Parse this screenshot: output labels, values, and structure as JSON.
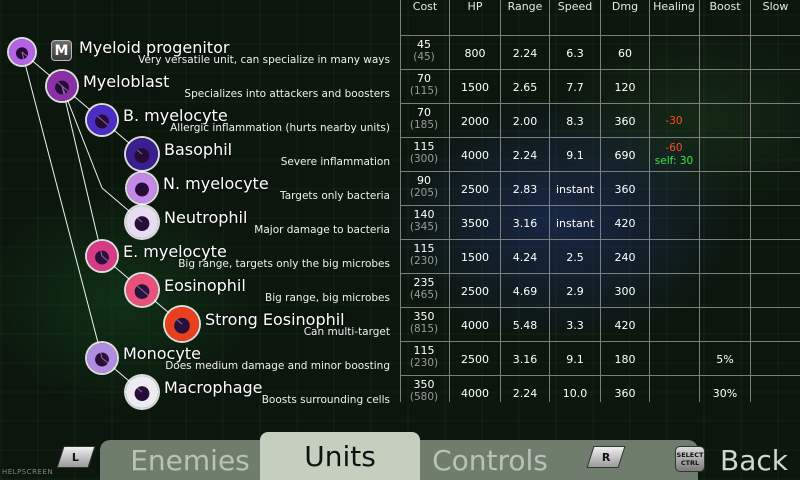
{
  "columns": {
    "cost": "Cost",
    "hp": "HP",
    "range": "Range",
    "speed": "Speed",
    "dmg": "Dmg",
    "healing": "Healing",
    "boost": "Boost",
    "slow": "Slow"
  },
  "badge": "M",
  "rows": [
    {
      "name": "Myeloid progenitor",
      "desc": "Very versatile unit, can specialize in many ways",
      "cost": "45",
      "cost_total": "(45)",
      "hp": "800",
      "range": "2.24",
      "speed": "6.3",
      "dmg": "60",
      "healing": "",
      "healing_self": "",
      "boost": "",
      "slow": "",
      "icon_color": "#b463e6"
    },
    {
      "name": "Myeloblast",
      "desc": "Specializes into attackers and boosters",
      "cost": "70",
      "cost_total": "(115)",
      "hp": "1500",
      "range": "2.65",
      "speed": "7.7",
      "dmg": "120",
      "healing": "",
      "healing_self": "",
      "boost": "",
      "slow": "",
      "icon_color": "#8a2fa5"
    },
    {
      "name": "B. myelocyte",
      "desc": "Allergic inflammation (hurts nearby units)",
      "cost": "70",
      "cost_total": "(185)",
      "hp": "2000",
      "range": "2.00",
      "speed": "8.3",
      "dmg": "360",
      "healing": "-30",
      "healing_self": "",
      "boost": "",
      "slow": "",
      "icon_color": "#4b2cc4"
    },
    {
      "name": "Basophil",
      "desc": "Severe inflammation",
      "cost": "115",
      "cost_total": "(300)",
      "hp": "4000",
      "range": "2.24",
      "speed": "9.1",
      "dmg": "690",
      "healing": "-60",
      "healing_self": "self: 30",
      "boost": "",
      "slow": "",
      "icon_color": "#3a1f8e"
    },
    {
      "name": "N. myelocyte",
      "desc": "Targets only bacteria",
      "cost": "90",
      "cost_total": "(205)",
      "hp": "2500",
      "range": "2.83",
      "speed": "instant",
      "dmg": "360",
      "healing": "",
      "healing_self": "",
      "boost": "",
      "slow": "",
      "icon_color": "#c48ae8"
    },
    {
      "name": "Neutrophil",
      "desc": "Major damage to bacteria",
      "cost": "140",
      "cost_total": "(345)",
      "hp": "3500",
      "range": "3.16",
      "speed": "instant",
      "dmg": "420",
      "healing": "",
      "healing_self": "",
      "boost": "",
      "slow": "",
      "icon_color": "#e9dcf2"
    },
    {
      "name": "E. myelocyte",
      "desc": "Big range, targets only the big microbes",
      "cost": "115",
      "cost_total": "(230)",
      "hp": "1500",
      "range": "4.24",
      "speed": "2.5",
      "dmg": "240",
      "healing": "",
      "healing_self": "",
      "boost": "",
      "slow": "",
      "icon_color": "#d83b85"
    },
    {
      "name": "Eosinophil",
      "desc": "Big range, big microbes",
      "cost": "235",
      "cost_total": "(465)",
      "hp": "2500",
      "range": "4.69",
      "speed": "2.9",
      "dmg": "300",
      "healing": "",
      "healing_self": "",
      "boost": "",
      "slow": "",
      "icon_color": "#e9507a"
    },
    {
      "name": "Strong Eosinophil",
      "desc": "Can multi-target",
      "cost": "350",
      "cost_total": "(815)",
      "hp": "4000",
      "range": "5.48",
      "speed": "3.3",
      "dmg": "420",
      "healing": "",
      "healing_self": "",
      "boost": "",
      "slow": "",
      "icon_color": "#e8401e"
    },
    {
      "name": "Monocyte",
      "desc": "Does medium damage and minor boosting",
      "cost": "115",
      "cost_total": "(230)",
      "hp": "2500",
      "range": "3.16",
      "speed": "9.1",
      "dmg": "180",
      "healing": "",
      "healing_self": "",
      "boost": "5%",
      "slow": "",
      "icon_color": "#b08de0"
    },
    {
      "name": "Macrophage",
      "desc": "Boosts surrounding cells",
      "cost": "350",
      "cost_total": "(580)",
      "hp": "4000",
      "range": "2.24",
      "speed": "10.0",
      "dmg": "360",
      "healing": "",
      "healing_self": "",
      "boost": "30%",
      "slow": "",
      "icon_color": "#ececf2"
    }
  ],
  "tabs": {
    "enemies": "Enemies",
    "units": "Units",
    "controls": "Controls",
    "active": "Units"
  },
  "buttons": {
    "l": "L",
    "r": "R",
    "select_top": "SELECT",
    "select_bottom": "CTRL",
    "back": "Back"
  },
  "help_label": "HELPSCREEN"
}
